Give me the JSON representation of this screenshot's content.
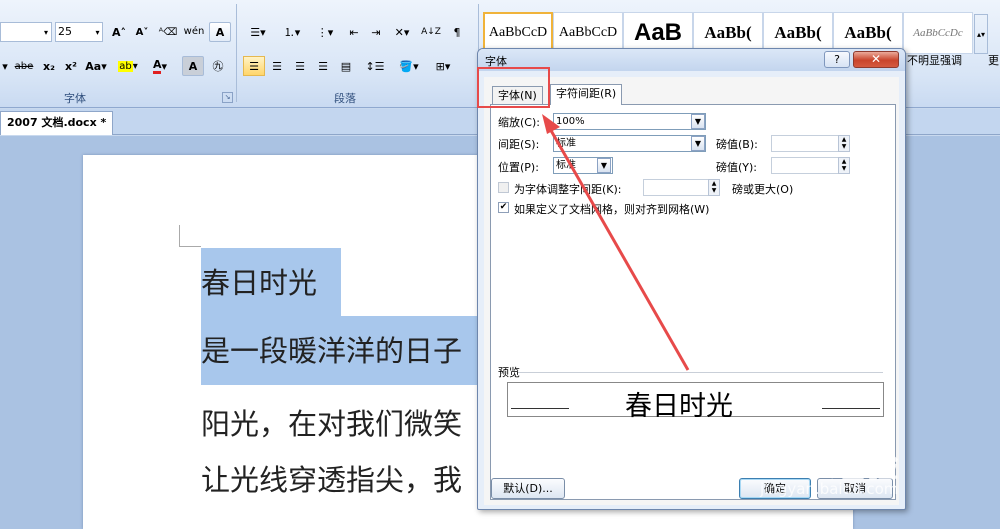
{
  "ribbon": {
    "font_size_value": "25",
    "font_group_label": "字体",
    "paragraph_group_label": "段落",
    "font_buttons_row2": [
      "abe",
      "x₂",
      "x²",
      "Aa▾"
    ],
    "text_effect_glyph": "A",
    "wen_glyph": "wén",
    "phonetic_glyph": "A",
    "styles": [
      {
        "label": "AaBbCcD",
        "selected": true
      },
      {
        "label": "AaBbCcD",
        "selected": false
      },
      {
        "label": "AaB",
        "selected": false
      },
      {
        "label": "AaBb(",
        "selected": false
      },
      {
        "label": "AaBb(",
        "selected": false
      },
      {
        "label": "AaBb(",
        "selected": false
      },
      {
        "label": "AaBbCcDc",
        "selected": false
      }
    ],
    "style_caption_visible": "不明显强调",
    "right_edge_glyph": "更"
  },
  "document": {
    "tab_title": "2007 文档.docx *",
    "lines": [
      {
        "text": "春日时光",
        "selected": true
      },
      {
        "text": "是一段暖洋洋的日子",
        "selected": true
      },
      {
        "text": "阳光，在对我们微笑",
        "selected": false
      },
      {
        "text": "让光线穿透指尖，我",
        "selected": false
      }
    ]
  },
  "dialog": {
    "title": "字体",
    "help_glyph": "?",
    "close_glyph": "✕",
    "tabs": [
      {
        "label": "字体(N)",
        "active": false
      },
      {
        "label": "字符间距(R)",
        "active": true
      }
    ],
    "scale_label": "缩放(C):",
    "scale_value": "100%",
    "spacing_label": "间距(S):",
    "spacing_value": "标准",
    "spacing_by_label": "磅值(B):",
    "position_label": "位置(P):",
    "position_value": "标准",
    "position_by_label": "磅值(Y):",
    "kerning_label": "为字体调整字间距(K):",
    "kerning_checked": false,
    "kerning_suffix": "磅或更大(O)",
    "grid_label": "如果定义了文档网格，则对齐到网格(W)",
    "grid_checked": true,
    "preview_label": "预览",
    "preview_text": "春日时光",
    "default_button": "默认(D)...",
    "ok_button": "确定",
    "cancel_button": "取消"
  },
  "watermark": {
    "brand": "Bai 经验",
    "url": "jingyan.baidu.com"
  },
  "colors": {
    "annotation": "#e74a4a",
    "selection": "#a8c7ec",
    "ribbon_bg": "#d8e5f6"
  }
}
